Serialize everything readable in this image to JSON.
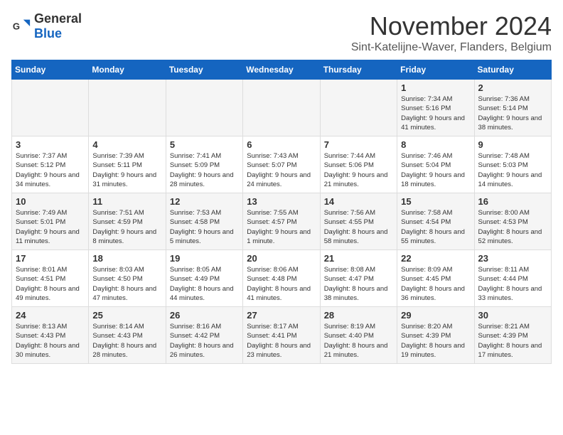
{
  "logo": {
    "text_general": "General",
    "text_blue": "Blue"
  },
  "title": "November 2024",
  "location": "Sint-Katelijne-Waver, Flanders, Belgium",
  "days_of_week": [
    "Sunday",
    "Monday",
    "Tuesday",
    "Wednesday",
    "Thursday",
    "Friday",
    "Saturday"
  ],
  "weeks": [
    [
      {
        "day": "",
        "info": ""
      },
      {
        "day": "",
        "info": ""
      },
      {
        "day": "",
        "info": ""
      },
      {
        "day": "",
        "info": ""
      },
      {
        "day": "",
        "info": ""
      },
      {
        "day": "1",
        "info": "Sunrise: 7:34 AM\nSunset: 5:16 PM\nDaylight: 9 hours and 41 minutes."
      },
      {
        "day": "2",
        "info": "Sunrise: 7:36 AM\nSunset: 5:14 PM\nDaylight: 9 hours and 38 minutes."
      }
    ],
    [
      {
        "day": "3",
        "info": "Sunrise: 7:37 AM\nSunset: 5:12 PM\nDaylight: 9 hours and 34 minutes."
      },
      {
        "day": "4",
        "info": "Sunrise: 7:39 AM\nSunset: 5:11 PM\nDaylight: 9 hours and 31 minutes."
      },
      {
        "day": "5",
        "info": "Sunrise: 7:41 AM\nSunset: 5:09 PM\nDaylight: 9 hours and 28 minutes."
      },
      {
        "day": "6",
        "info": "Sunrise: 7:43 AM\nSunset: 5:07 PM\nDaylight: 9 hours and 24 minutes."
      },
      {
        "day": "7",
        "info": "Sunrise: 7:44 AM\nSunset: 5:06 PM\nDaylight: 9 hours and 21 minutes."
      },
      {
        "day": "8",
        "info": "Sunrise: 7:46 AM\nSunset: 5:04 PM\nDaylight: 9 hours and 18 minutes."
      },
      {
        "day": "9",
        "info": "Sunrise: 7:48 AM\nSunset: 5:03 PM\nDaylight: 9 hours and 14 minutes."
      }
    ],
    [
      {
        "day": "10",
        "info": "Sunrise: 7:49 AM\nSunset: 5:01 PM\nDaylight: 9 hours and 11 minutes."
      },
      {
        "day": "11",
        "info": "Sunrise: 7:51 AM\nSunset: 4:59 PM\nDaylight: 9 hours and 8 minutes."
      },
      {
        "day": "12",
        "info": "Sunrise: 7:53 AM\nSunset: 4:58 PM\nDaylight: 9 hours and 5 minutes."
      },
      {
        "day": "13",
        "info": "Sunrise: 7:55 AM\nSunset: 4:57 PM\nDaylight: 9 hours and 1 minute."
      },
      {
        "day": "14",
        "info": "Sunrise: 7:56 AM\nSunset: 4:55 PM\nDaylight: 8 hours and 58 minutes."
      },
      {
        "day": "15",
        "info": "Sunrise: 7:58 AM\nSunset: 4:54 PM\nDaylight: 8 hours and 55 minutes."
      },
      {
        "day": "16",
        "info": "Sunrise: 8:00 AM\nSunset: 4:53 PM\nDaylight: 8 hours and 52 minutes."
      }
    ],
    [
      {
        "day": "17",
        "info": "Sunrise: 8:01 AM\nSunset: 4:51 PM\nDaylight: 8 hours and 49 minutes."
      },
      {
        "day": "18",
        "info": "Sunrise: 8:03 AM\nSunset: 4:50 PM\nDaylight: 8 hours and 47 minutes."
      },
      {
        "day": "19",
        "info": "Sunrise: 8:05 AM\nSunset: 4:49 PM\nDaylight: 8 hours and 44 minutes."
      },
      {
        "day": "20",
        "info": "Sunrise: 8:06 AM\nSunset: 4:48 PM\nDaylight: 8 hours and 41 minutes."
      },
      {
        "day": "21",
        "info": "Sunrise: 8:08 AM\nSunset: 4:47 PM\nDaylight: 8 hours and 38 minutes."
      },
      {
        "day": "22",
        "info": "Sunrise: 8:09 AM\nSunset: 4:45 PM\nDaylight: 8 hours and 36 minutes."
      },
      {
        "day": "23",
        "info": "Sunrise: 8:11 AM\nSunset: 4:44 PM\nDaylight: 8 hours and 33 minutes."
      }
    ],
    [
      {
        "day": "24",
        "info": "Sunrise: 8:13 AM\nSunset: 4:43 PM\nDaylight: 8 hours and 30 minutes."
      },
      {
        "day": "25",
        "info": "Sunrise: 8:14 AM\nSunset: 4:43 PM\nDaylight: 8 hours and 28 minutes."
      },
      {
        "day": "26",
        "info": "Sunrise: 8:16 AM\nSunset: 4:42 PM\nDaylight: 8 hours and 26 minutes."
      },
      {
        "day": "27",
        "info": "Sunrise: 8:17 AM\nSunset: 4:41 PM\nDaylight: 8 hours and 23 minutes."
      },
      {
        "day": "28",
        "info": "Sunrise: 8:19 AM\nSunset: 4:40 PM\nDaylight: 8 hours and 21 minutes."
      },
      {
        "day": "29",
        "info": "Sunrise: 8:20 AM\nSunset: 4:39 PM\nDaylight: 8 hours and 19 minutes."
      },
      {
        "day": "30",
        "info": "Sunrise: 8:21 AM\nSunset: 4:39 PM\nDaylight: 8 hours and 17 minutes."
      }
    ]
  ]
}
